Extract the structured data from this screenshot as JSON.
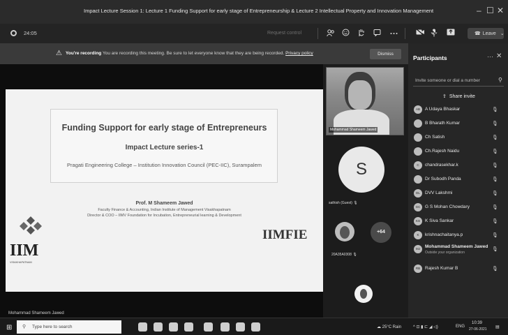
{
  "window": {
    "title": "Impact Lecture Session 1: Lecture 1 Funding Support for early stage of Entrepreneurship & Lecture 2 Intellectual Property and Innovation Management",
    "minimize": "–",
    "maximize": "☐",
    "close": "✕"
  },
  "toolbar": {
    "timer": "24:05",
    "request_control": "Request control",
    "leave_label": "Leave"
  },
  "banner": {
    "bold": "You're recording",
    "message": " You are recording this meeting. Be sure to let everyone know that they are being recorded.",
    "privacy": "Privacy policy",
    "dismiss": "Dismiss"
  },
  "slide": {
    "title": "Funding Support for early stage of Entrepreneurs",
    "subtitle": "Impact Lecture series-1",
    "college": "Pragati Engineering College – Institution Innovation Council (PEC-IIC), Surampalem",
    "presenter": "Prof. M Shameem Jawed",
    "line1": "Faculty Finance & Accounting, Indian Institute of Management Visakhapatnam",
    "line2": "Director & COO – IIMV Foundation for Incubation, Entrepreneurial learning & Development",
    "logo_left": "IIM",
    "logo_left_sub": "VISAKHAPATNAM",
    "logo_right": "IIMFIE",
    "presenter_label": "Mohammad Shameem Jawed"
  },
  "tiles": {
    "video_name": "Mohammad Shameem Jawed",
    "avatar_letter": "S",
    "avatar_label": "sathish (Guest)",
    "small_label": "20A35A0308",
    "overflow": "+64"
  },
  "participants": {
    "header": "Participants",
    "search_placeholder": "Invite someone or dial a number",
    "share": "Share invite",
    "items": [
      {
        "initials": "AB",
        "name": "A Udaya Bhaskar",
        "sub": ""
      },
      {
        "initials": "",
        "name": "B Bharath Kumar",
        "sub": ""
      },
      {
        "initials": "",
        "name": "Ch Satish",
        "sub": ""
      },
      {
        "initials": "",
        "name": "Ch.Rajesh Naidu",
        "sub": ""
      },
      {
        "initials": "C",
        "name": "chandrasekhar.k",
        "sub": ""
      },
      {
        "initials": "",
        "name": "Dr Subodh Panda",
        "sub": ""
      },
      {
        "initials": "DL",
        "name": "DVV Lakshmi",
        "sub": ""
      },
      {
        "initials": "GC",
        "name": "G S Mohan Chowdary",
        "sub": ""
      },
      {
        "initials": "KS",
        "name": "K Siva Sankar",
        "sub": ""
      },
      {
        "initials": "K",
        "name": "krishnachaitanya.p",
        "sub": ""
      },
      {
        "initials": "MJ",
        "name": "Mohammad Shameem Jawed",
        "sub": "Outside your organization"
      },
      {
        "initials": "RB",
        "name": "Rajesh Kumar B",
        "sub": ""
      }
    ]
  },
  "taskbar": {
    "search": "Type here to search",
    "weather": "25°C Rain",
    "lang": "ENG",
    "time": "10:39",
    "date": "27-06-2021"
  }
}
